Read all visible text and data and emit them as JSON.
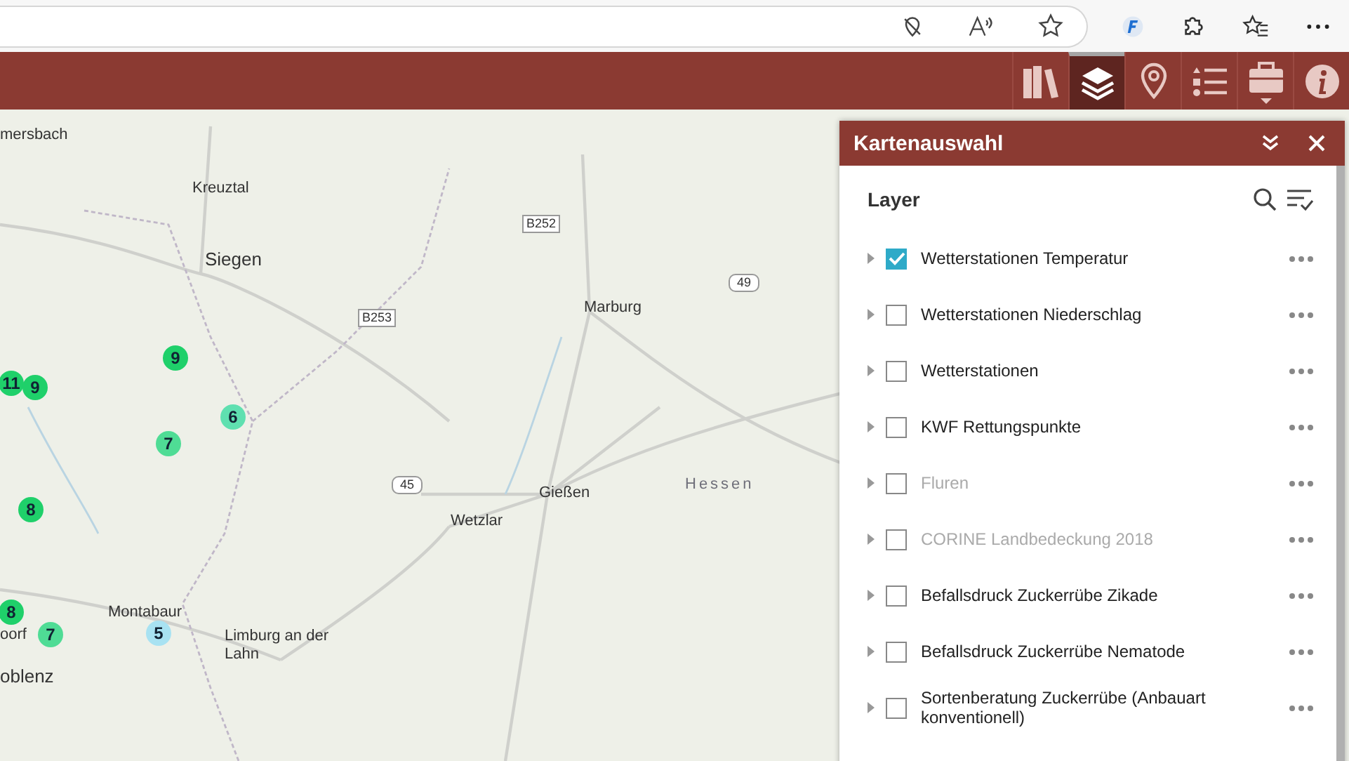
{
  "toolbar": {
    "buttons": [
      {
        "kind": "library",
        "selected": false
      },
      {
        "kind": "layers",
        "selected": true
      },
      {
        "kind": "pin",
        "selected": false
      },
      {
        "kind": "legend",
        "selected": false
      },
      {
        "kind": "toolbox",
        "selected": false
      },
      {
        "kind": "info",
        "selected": false
      }
    ]
  },
  "map": {
    "labels": [
      {
        "text": "mersbach",
        "kind": "town"
      },
      {
        "text": "Kreuztal",
        "kind": "town"
      },
      {
        "text": "Siegen",
        "kind": "city"
      },
      {
        "text": "Marburg",
        "kind": "town"
      },
      {
        "text": "Gießen",
        "kind": "town"
      },
      {
        "text": "Wetzlar",
        "kind": "town"
      },
      {
        "text": "Hessen",
        "kind": "region"
      },
      {
        "text": "Montabaur",
        "kind": "town"
      },
      {
        "text": "oorf",
        "kind": "town"
      },
      {
        "text": "Limburg an der Lahn",
        "kind": "town"
      },
      {
        "text": "oblenz",
        "kind": "city"
      }
    ],
    "shields": [
      {
        "text": "B252",
        "kind": "federal"
      },
      {
        "text": "B253",
        "kind": "federal"
      },
      {
        "text": "45",
        "kind": "motorway"
      },
      {
        "text": "49",
        "kind": "motorway"
      }
    ],
    "markers": [
      {
        "count": "11",
        "color": "#1fd06a"
      },
      {
        "count": "9",
        "color": "#1fd06a"
      },
      {
        "count": "9",
        "color": "#1fd06a"
      },
      {
        "count": "6",
        "color": "#5fe0b0"
      },
      {
        "count": "7",
        "color": "#4fdc95"
      },
      {
        "count": "8",
        "color": "#1fd06a"
      },
      {
        "count": "8",
        "color": "#1fd06a"
      },
      {
        "count": "7",
        "color": "#4fdc95"
      },
      {
        "count": "5",
        "color": "#a8e2f2"
      }
    ]
  },
  "panel": {
    "title": "Kartenauswahl",
    "heading": "Layer",
    "layers": [
      {
        "label": "Wetterstationen Temperatur",
        "checked": true,
        "disabled": false
      },
      {
        "label": "Wetterstationen Niederschlag",
        "checked": false,
        "disabled": false
      },
      {
        "label": "Wetterstationen",
        "checked": false,
        "disabled": false
      },
      {
        "label": "KWF Rettungspunkte",
        "checked": false,
        "disabled": false
      },
      {
        "label": "Fluren",
        "checked": false,
        "disabled": true
      },
      {
        "label": "CORINE Landbedeckung 2018",
        "checked": false,
        "disabled": true
      },
      {
        "label": "Befallsdruck Zuckerrübe Zikade",
        "checked": false,
        "disabled": false
      },
      {
        "label": "Befallsdruck Zuckerrübe Nematode",
        "checked": false,
        "disabled": false
      },
      {
        "label": "Sortenberatung Zuckerrübe (Anbauart konventionell)",
        "checked": false,
        "disabled": false
      }
    ]
  }
}
